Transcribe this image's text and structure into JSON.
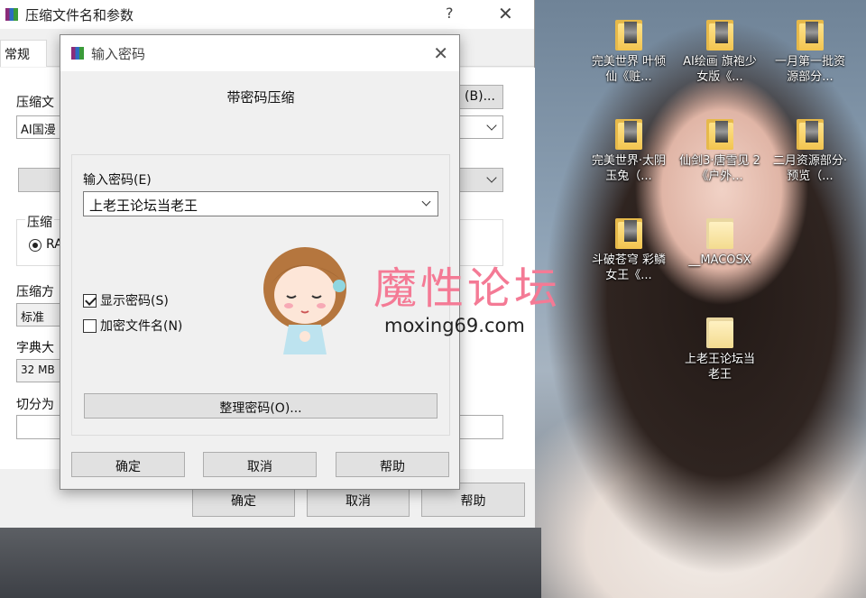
{
  "desktop": {
    "icons": [
      {
        "label": "完美世界 叶倾仙《赃..."
      },
      {
        "label": "AI绘画 旗袍少女版《..."
      },
      {
        "label": "一月第一批资源部分..."
      },
      {
        "label": "完美世界·太阴玉兔（..."
      },
      {
        "label": "仙剑3·唐雪见 2《户外..."
      },
      {
        "label": "二月资源部分·预览（..."
      },
      {
        "label": "斗破苍穹 彩鳞女王《..."
      },
      {
        "label": "__MACOSX"
      },
      {
        "label": "上老王论坛当老王"
      }
    ]
  },
  "main_dialog": {
    "title": "压缩文件名和参数",
    "help_glyph": "?",
    "close_glyph": "✕",
    "tab_general": "常规",
    "archive_name_label": "压缩文",
    "archive_name_value": "AI国漫",
    "browse_button": "(B)...",
    "format_label": "压缩",
    "format_option": "RA",
    "method_label": "压缩方",
    "method_value": "标准",
    "dict_label": "字典大",
    "dict_value": "32 MB",
    "split_label": "切分为",
    "ok_button": "确定",
    "cancel_button": "取消",
    "help_button": "帮助"
  },
  "password_dialog": {
    "title": "输入密码",
    "close_glyph": "✕",
    "heading": "带密码压缩",
    "password_label": "输入密码(E)",
    "password_value": "上老王论坛当老王",
    "show_password_label": "显示密码(S)",
    "show_password_checked": true,
    "encrypt_names_label": "加密文件名(N)",
    "encrypt_names_checked": false,
    "organize_button": "整理密码(O)...",
    "ok_button": "确定",
    "cancel_button": "取消",
    "help_button": "帮助"
  },
  "watermark": {
    "text": "魔性论坛",
    "url": "moxing69.com"
  }
}
